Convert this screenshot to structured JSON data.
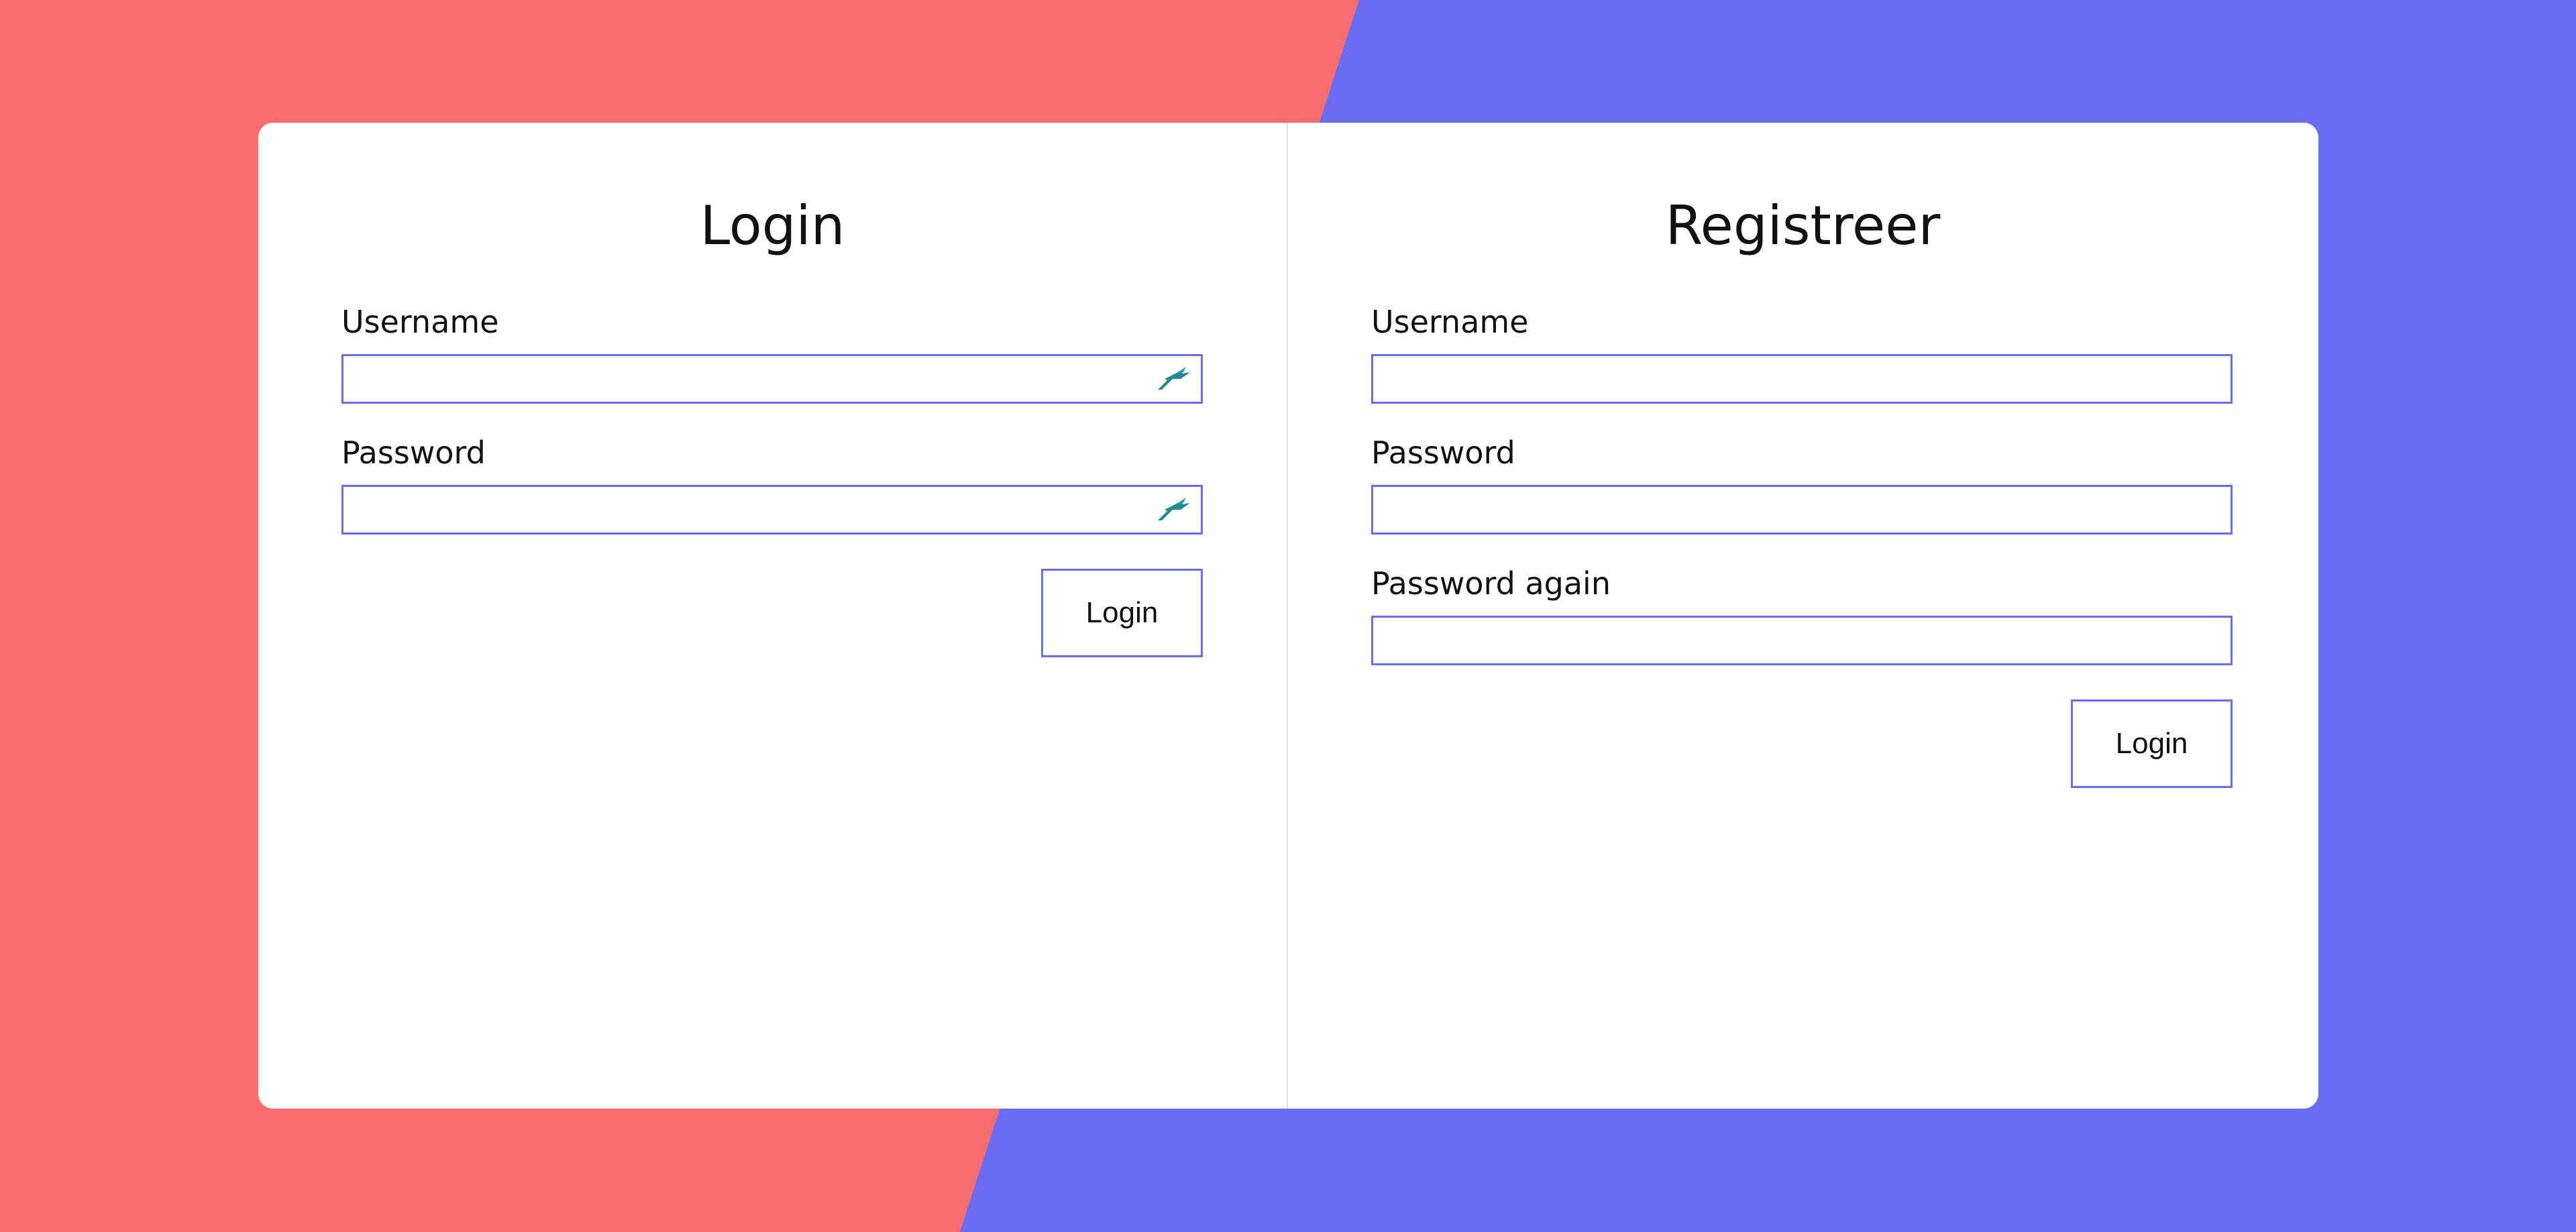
{
  "login": {
    "title": "Login",
    "username_label": "Username",
    "username_value": "",
    "password_label": "Password",
    "password_value": "",
    "submit_label": "Login",
    "field_icon": "password-manager-icon"
  },
  "register": {
    "title": "Registreer",
    "username_label": "Username",
    "username_value": "",
    "password_label": "Password",
    "password_value": "",
    "password_again_label": "Password again",
    "password_again_value": "",
    "submit_label": "Login"
  },
  "colors": {
    "background_left": "#f96c6d",
    "background_right": "#6a6df1",
    "accent": "#6a6df1",
    "card": "#ffffff"
  }
}
